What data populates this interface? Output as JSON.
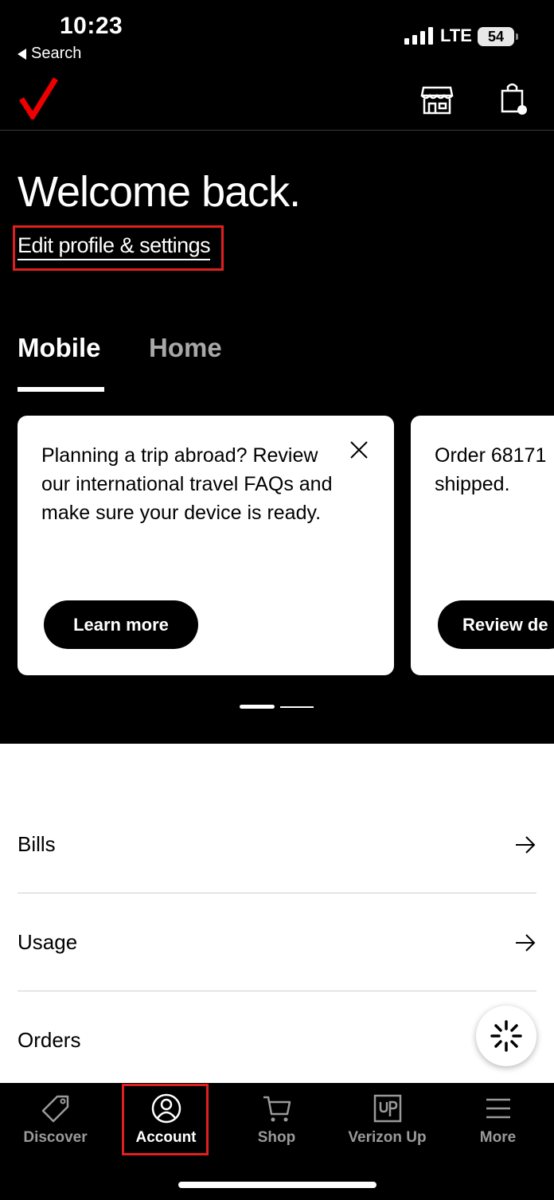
{
  "status_bar": {
    "time": "10:23",
    "back_label": "Search",
    "network": "LTE",
    "battery": "54"
  },
  "header": {
    "logo_icon": "verizon-check-logo",
    "store_icon": "store-icon",
    "bag_icon": "shopping-bag-icon"
  },
  "welcome": {
    "title": "Welcome back.",
    "edit_link": "Edit profile & settings"
  },
  "tabs": [
    {
      "label": "Mobile",
      "active": true
    },
    {
      "label": "Home",
      "active": false
    }
  ],
  "cards": [
    {
      "text": "Planning a trip abroad? Review our international travel FAQs and make sure your device is ready.",
      "button": "Learn more"
    },
    {
      "text": "Order 68171",
      "text2": "shipped.",
      "button": "Review de"
    }
  ],
  "list": [
    {
      "label": "Bills"
    },
    {
      "label": "Usage"
    },
    {
      "label": "Orders"
    }
  ],
  "bottom_nav": [
    {
      "label": "Discover",
      "icon": "tag-icon",
      "active": false
    },
    {
      "label": "Account",
      "icon": "account-icon",
      "active": true
    },
    {
      "label": "Shop",
      "icon": "cart-icon",
      "active": false
    },
    {
      "label": "Verizon Up",
      "icon": "up-icon",
      "active": false
    },
    {
      "label": "More",
      "icon": "menu-icon",
      "active": false
    }
  ],
  "colors": {
    "brand_red": "#ee0000",
    "highlight_red": "#e02020",
    "inactive_gray": "#9a9a9a"
  }
}
